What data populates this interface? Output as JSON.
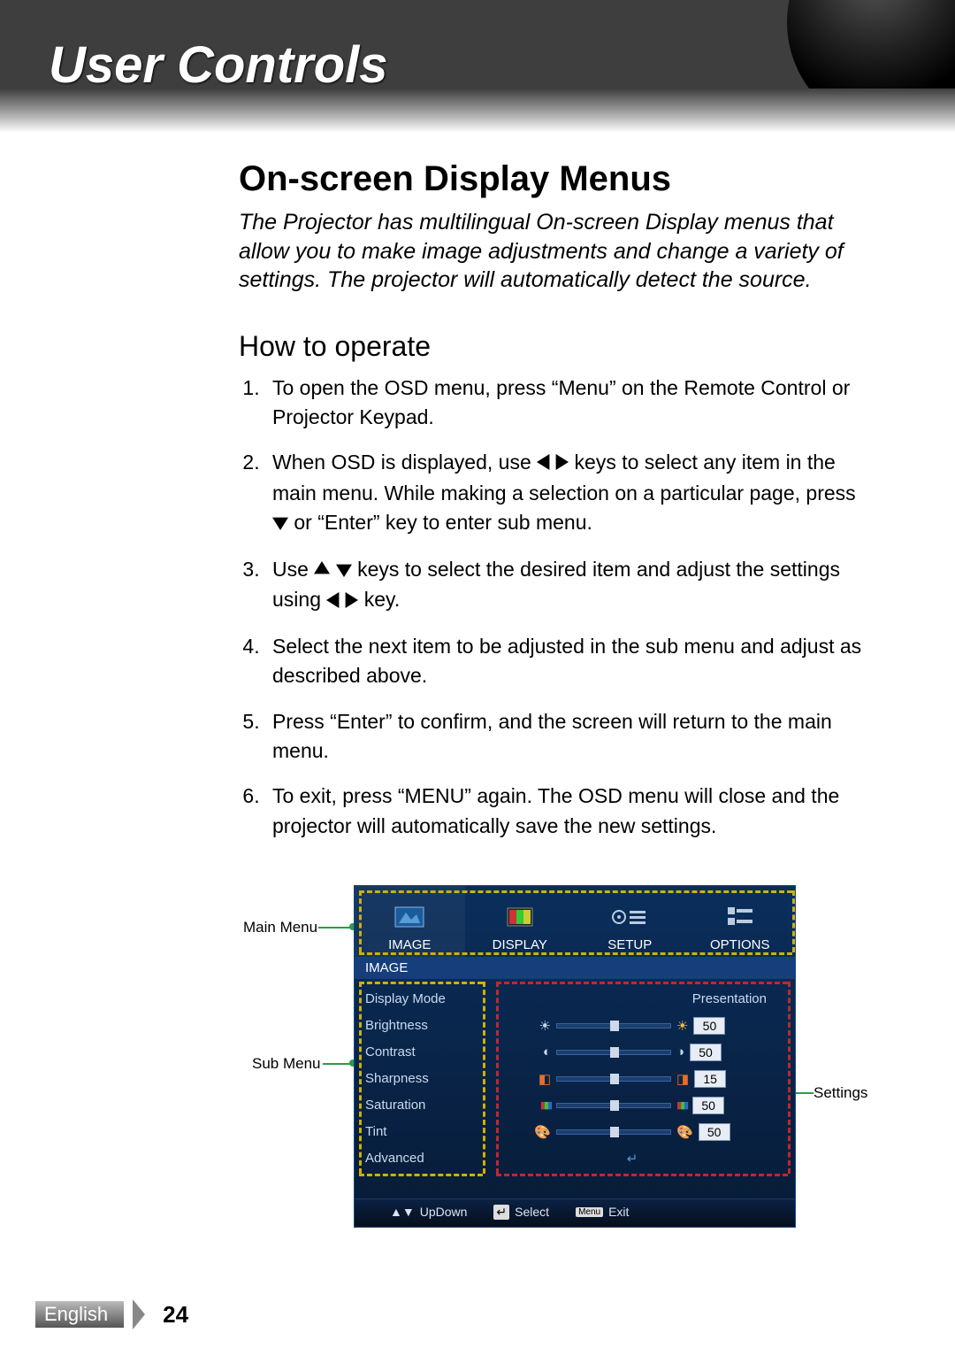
{
  "header": {
    "title": "User Controls"
  },
  "section": {
    "title": "On-screen Display Menus",
    "intro": "The Projector has multilingual On-screen Display menus that allow you to make image adjustments and change a variety of settings. The projector will automatically detect the source.",
    "subtitle": "How to operate",
    "steps": {
      "s1": "To open the OSD menu, press “Menu” on the Remote Control or Projector Keypad.",
      "s2a": "When OSD is displayed, use ",
      "s2b": " keys to select any item in the main menu. While making a selection on a particular page, press ",
      "s2c": " or “Enter” key to enter sub menu.",
      "s3a": "Use ",
      "s3b": " keys to select the desired item and adjust the settings using ",
      "s3c": " key.",
      "s4": "Select the next item to be adjusted in the sub menu and adjust as described above.",
      "s5": "Press “Enter” to confirm, and the screen will return to the main menu.",
      "s6": "To exit, press “MENU” again. The OSD menu will close and the projector will automatically save the new settings."
    }
  },
  "labels": {
    "main_menu": "Main Menu",
    "sub_menu": "Sub Menu",
    "settings": "Settings"
  },
  "osd": {
    "tabs": [
      "IMAGE",
      "DISPLAY",
      "SETUP",
      "OPTIONS"
    ],
    "section": "IMAGE",
    "rows": [
      {
        "label": "Display Mode",
        "value_text": "Presentation"
      },
      {
        "label": "Brightness",
        "value": 50
      },
      {
        "label": "Contrast",
        "value": 50
      },
      {
        "label": "Sharpness",
        "value": 15
      },
      {
        "label": "Saturation",
        "value": 50
      },
      {
        "label": "Tint",
        "value": 50
      },
      {
        "label": "Advanced"
      }
    ],
    "footer": {
      "updown": "UpDown",
      "select": "Select",
      "exit": "Exit",
      "menu": "Menu"
    }
  },
  "footer": {
    "lang": "English",
    "page": "24"
  }
}
